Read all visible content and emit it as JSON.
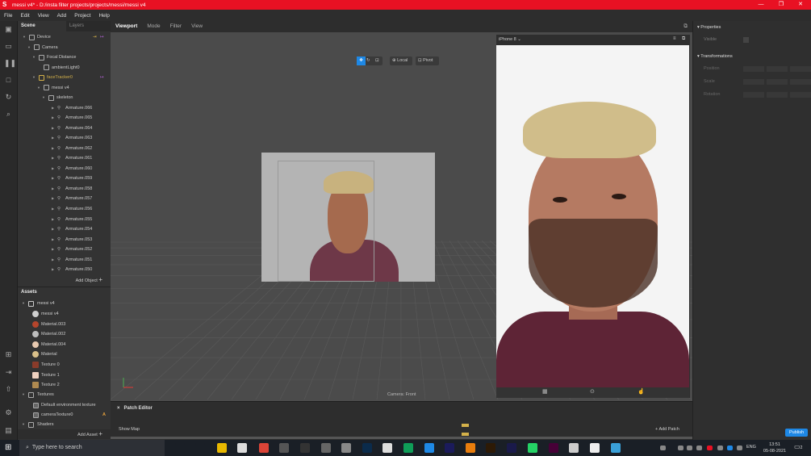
{
  "window": {
    "title": "messi v4* - D:/insta filter projects/projects/messi/messi v4",
    "minimize": "—",
    "maximize": "❐",
    "close": "✕"
  },
  "menu": [
    "File",
    "Edit",
    "View",
    "Add",
    "Project",
    "Help"
  ],
  "scene": {
    "tabs": [
      "Scene",
      "Layers"
    ],
    "nodes": [
      {
        "label": "Device",
        "indent": 0,
        "twisty": "▼"
      },
      {
        "label": "Camera",
        "indent": 1,
        "twisty": "▼"
      },
      {
        "label": "Focal Distance",
        "indent": 2,
        "twisty": "▼"
      },
      {
        "label": "ambientLight0",
        "indent": 3,
        "twisty": ""
      },
      {
        "label": "faceTracker0",
        "indent": 2,
        "twisty": "▼"
      },
      {
        "label": "messi v4",
        "indent": 3,
        "twisty": "▼"
      },
      {
        "label": "skeleton",
        "indent": 4,
        "twisty": "▼"
      }
    ],
    "armatures": [
      "Armature.066",
      "Armature.065",
      "Armature.064",
      "Armature.063",
      "Armature.062",
      "Armature.061",
      "Armature.060",
      "Armature.059",
      "Armature.058",
      "Armature.057",
      "Armature.056",
      "Armature.055",
      "Armature.054",
      "Armature.053",
      "Armature.052",
      "Armature.051",
      "Armature.050"
    ],
    "add_object": "Add Object"
  },
  "assets": {
    "title": "Assets",
    "root": "messi v4",
    "items": [
      {
        "label": "messi v4",
        "color": "#cfcfcf"
      },
      {
        "label": "Material.003",
        "color": "#b5452c"
      },
      {
        "label": "Material.002",
        "color": "#bdbdbd"
      },
      {
        "label": "Material.004",
        "color": "#e8c9b0"
      },
      {
        "label": "Material",
        "color": "#d9c08a"
      },
      {
        "label": "Texture 0",
        "color": "#8a3b2a"
      },
      {
        "label": "Texture 1",
        "color": "#f0d2c0"
      },
      {
        "label": "Texture 2",
        "color": "#b08a50"
      }
    ],
    "textures_folder": "Textures",
    "textures": [
      "Default environment texture",
      "cameraTexture0"
    ],
    "warning": "A",
    "shaders_folder": "Shaders",
    "add_asset": "Add Asset"
  },
  "viewport": {
    "tabs": [
      "Viewport",
      "Mode",
      "Filter",
      "View"
    ],
    "local": "Local",
    "pivot": "Pivot",
    "camera_label": "Camera: Front"
  },
  "simulator": {
    "device": "iPhone 8"
  },
  "properties": {
    "title": "Properties",
    "visible": "Visible",
    "transformations": "Transformations",
    "rows": [
      "Position",
      "Scale",
      "Rotation"
    ]
  },
  "patch": {
    "title": "Patch Editor",
    "show_map": "Show Map",
    "add_patch": "Add Patch",
    "publish": "Publish"
  },
  "taskbar": {
    "search": "Type here to search",
    "lang": "ENG",
    "time": "13:51",
    "date": "05-08-2021",
    "notif": "2"
  }
}
